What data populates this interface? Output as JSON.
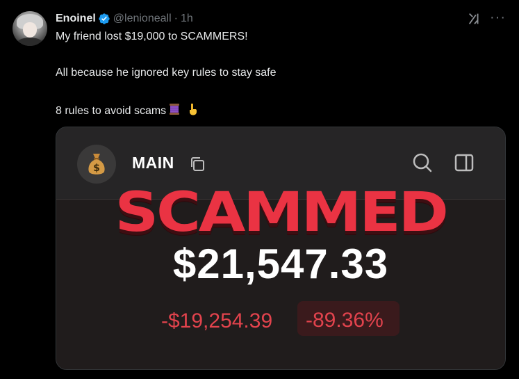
{
  "tweet": {
    "display_name": "Enoinel",
    "handle": "@lenioneall",
    "separator": "·",
    "time": "1h",
    "line1": "My friend lost $19,000 to SCAMMERS!",
    "line2": "All because he ignored key rules to stay safe",
    "line3": "8 rules to avoid scams",
    "line3_emojis": [
      "thread-icon",
      "pointing-down-icon"
    ],
    "header_icons": [
      "verified-badge-icon",
      "grok-icon",
      "more-icon"
    ]
  },
  "card": {
    "wallet_label": "MAIN",
    "overlay_text": "SCAMMED",
    "balance": "$21,547.33",
    "change_amount": "-$19,254.39",
    "change_percent": "-89.36%",
    "icons": [
      "money-bag-icon",
      "copy-icon",
      "search-icon",
      "side-panel-icon"
    ],
    "colors": {
      "overlay_red": "#ea3343",
      "loss_red": "#e2434d",
      "verified_blue": "#1d9bf0"
    }
  }
}
